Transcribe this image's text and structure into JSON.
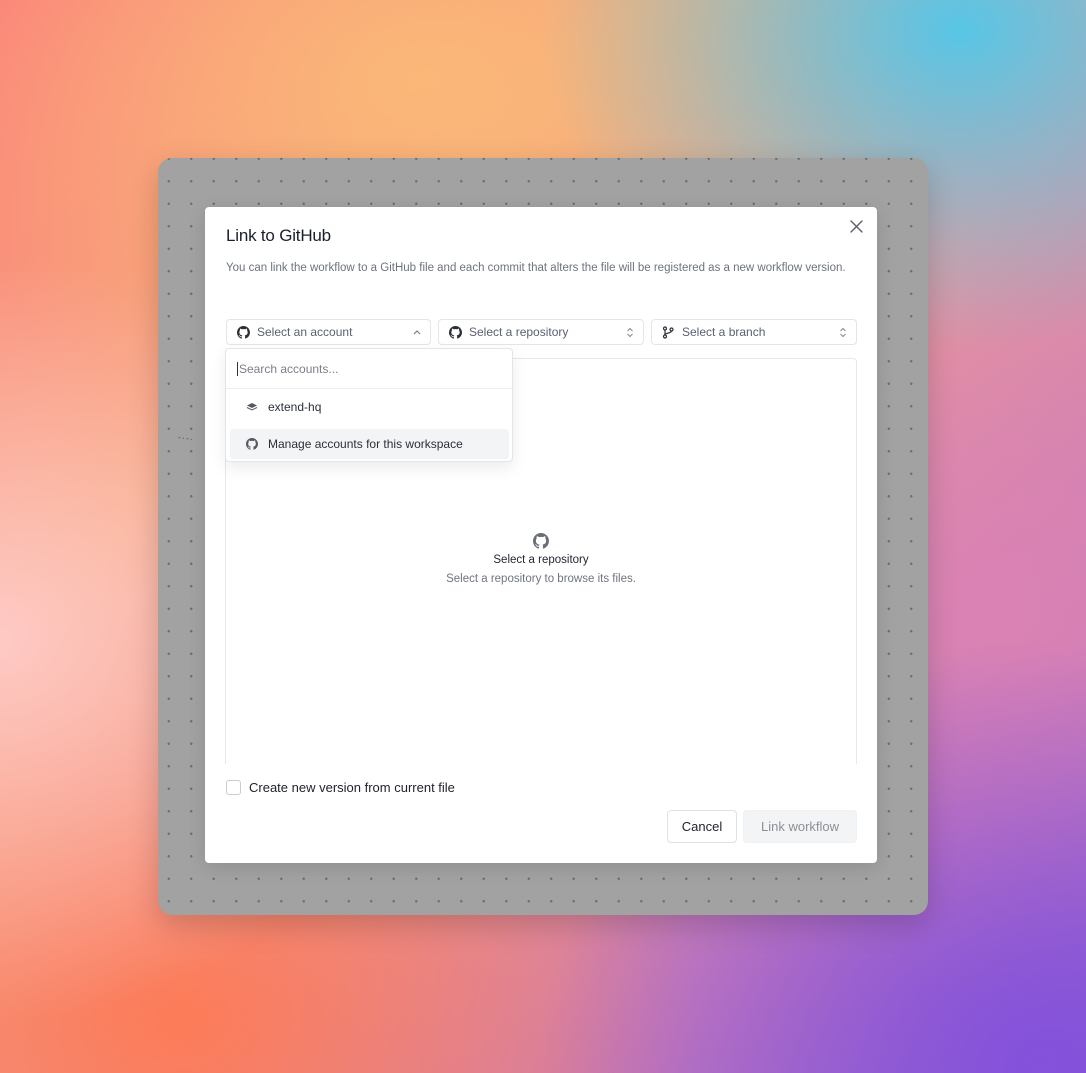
{
  "dialog": {
    "title": "Link to GitHub",
    "description": "You can link the workflow to a GitHub file and each commit that alters the file will be registered as a new workflow version."
  },
  "selectors": {
    "account": {
      "label": "Select an account",
      "icon": "github-icon",
      "chevron": "chevron-up-icon"
    },
    "repository": {
      "label": "Select a repository",
      "icon": "github-icon",
      "chevron": "chevron-up-down-icon"
    },
    "branch": {
      "label": "Select a branch",
      "icon": "git-branch-icon",
      "chevron": "chevron-up-down-icon"
    }
  },
  "account_dropdown": {
    "search_placeholder": "Search accounts...",
    "items": [
      {
        "label": "extend-hq",
        "icon": "organization-icon"
      },
      {
        "label": "Manage accounts for this workspace",
        "icon": "github-icon"
      }
    ]
  },
  "empty_state": {
    "title": "Select a repository",
    "subtitle": "Select a repository to browse its files.",
    "icon": "github-icon"
  },
  "checkbox": {
    "label": "Create new version from current file",
    "checked": false
  },
  "footer": {
    "cancel_label": "Cancel",
    "submit_label": "Link workflow"
  },
  "colors": {
    "dialog_bg": "#ffffff",
    "frame_bg": "#a2a2a2",
    "text_primary": "#1a1f2b",
    "text_muted": "#6c7280",
    "disabled_button_bg": "#f3f4f5"
  }
}
